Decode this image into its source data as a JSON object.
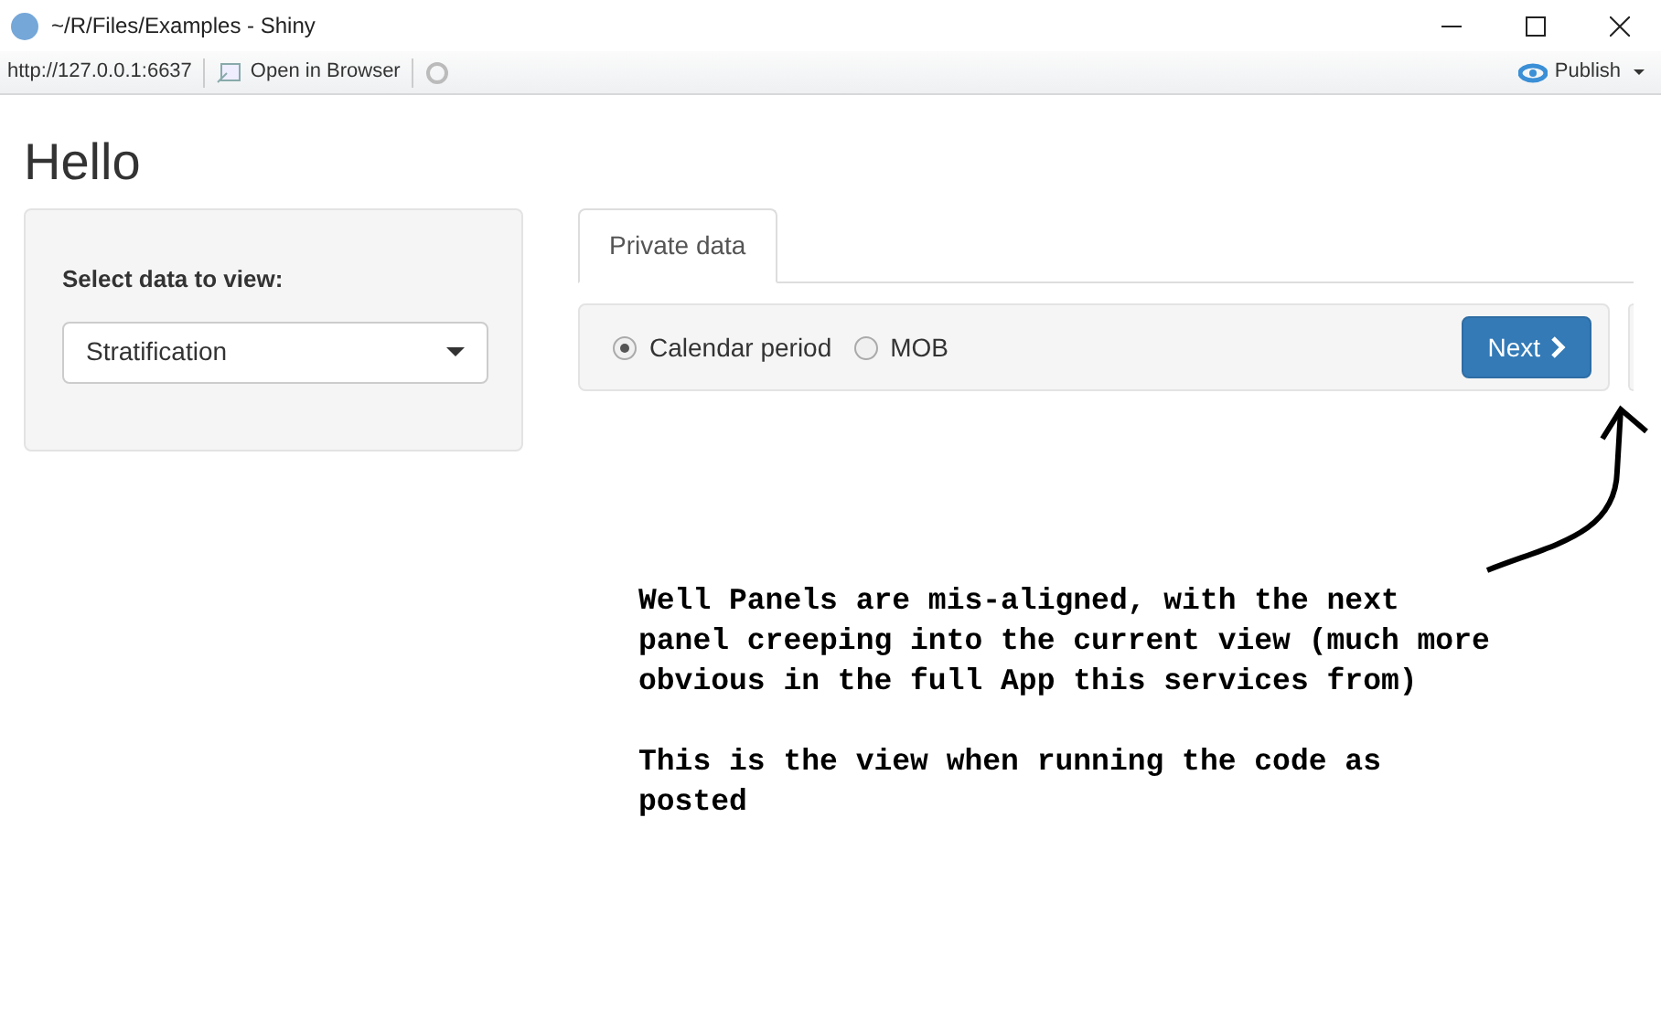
{
  "window": {
    "title": "~/R/Files/Examples - Shiny"
  },
  "toolbar": {
    "url": "http://127.0.0.1:6637",
    "open_button": "Open in Browser",
    "publish_button": "Publish"
  },
  "page": {
    "heading": "Hello",
    "sidebar": {
      "label": "Select data to view:",
      "select_value": "Stratification"
    },
    "tabs": [
      {
        "label": "Private data",
        "selected": true
      }
    ],
    "radios": [
      {
        "label": "Calendar period",
        "selected": true
      },
      {
        "label": "MOB",
        "selected": false
      }
    ],
    "next_button": "Next"
  },
  "annotation": {
    "paragraphs": [
      "Well Panels are mis-aligned, with the next panel creeping into the current view (much more obvious in the full App this services from)",
      "This is the view when running the code as posted"
    ]
  }
}
